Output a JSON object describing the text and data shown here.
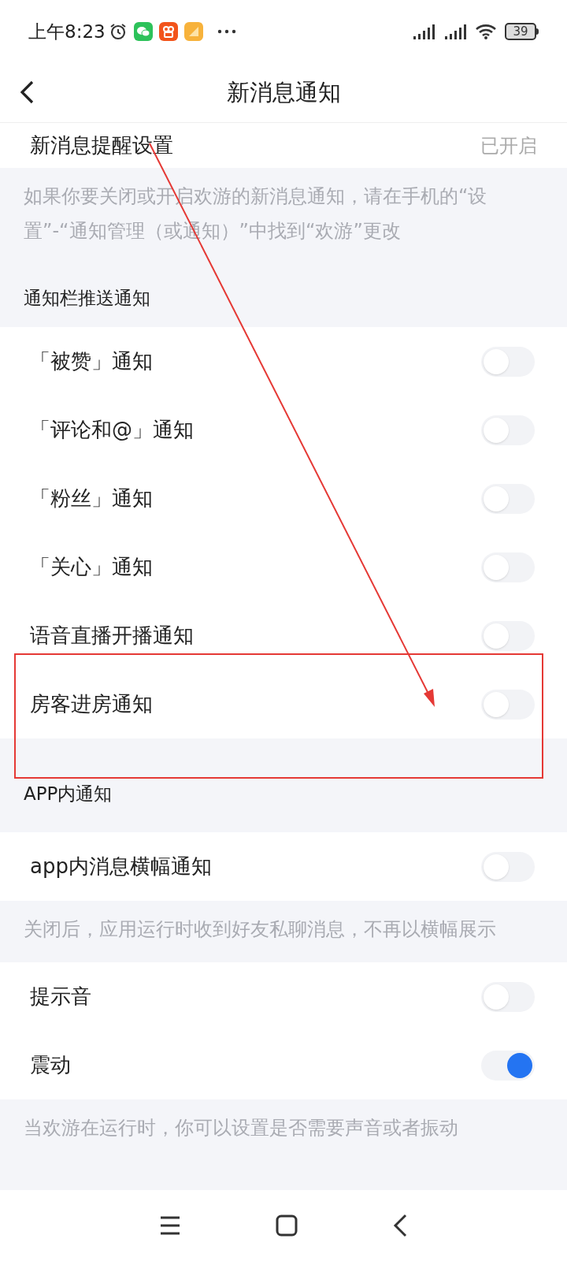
{
  "status_bar": {
    "time": "上午8:23",
    "battery": "39"
  },
  "header": {
    "title": "新消息通知"
  },
  "sections": [
    {
      "kind": "value_row",
      "label": "新消息提醒设置",
      "value": "已开启"
    },
    {
      "kind": "note",
      "text": "如果你要关闭或开启欢游的新消息通知，请在手机的“设置”-“通知管理（或通知）”中找到“欢游”更改"
    },
    {
      "kind": "heading",
      "text": "通知栏推送通知"
    },
    {
      "kind": "toggles",
      "items": [
        {
          "label": "「被赞」通知",
          "on": false
        },
        {
          "label": "「评论和@」通知",
          "on": false
        },
        {
          "label": "「粉丝」通知",
          "on": false
        },
        {
          "label": "「关心」通知",
          "on": false
        },
        {
          "label": "语音直播开播通知",
          "on": false
        },
        {
          "label": "房客进房通知",
          "on": false
        }
      ]
    },
    {
      "kind": "heading",
      "text": "APP内通知"
    },
    {
      "kind": "toggles",
      "items": [
        {
          "label": "app内消息横幅通知",
          "on": false
        }
      ]
    },
    {
      "kind": "note",
      "text": "关闭后，应用运行时收到好友私聊消息，不再以横幅展示"
    },
    {
      "kind": "toggles",
      "items": [
        {
          "label": "提示音",
          "on": false
        },
        {
          "label": "震动",
          "on": true
        }
      ]
    },
    {
      "kind": "note",
      "text": "当欢游在运行时，你可以设置是否需要声音或者振动"
    }
  ]
}
